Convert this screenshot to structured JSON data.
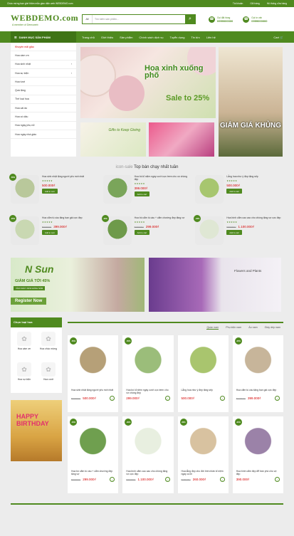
{
  "topbar": {
    "notice": "Chào mừng bạn ghé thăm mẫu giao diện web WEBDEMO.com",
    "links": [
      "Tài khoản",
      "Giỏ hàng",
      "Hệ thống cửa hàng"
    ]
  },
  "header": {
    "logo": "WEBDEMO.com",
    "tagline": "A member of Demoweb",
    "search_cat": "All",
    "search_placeholder": "Tìm kiếm sản phẩm...",
    "contacts": [
      {
        "label": "Gọi đặt hàng",
        "value": "0999000000"
      },
      {
        "label": "Gọi tư vấn",
        "value": "0999000000"
      }
    ]
  },
  "nav": {
    "menu_label": "DANH MỤC SẢN PHẨM",
    "items": [
      "Trang chủ",
      "Giới thiệu",
      "Sản phẩm",
      "Chính sách dịch vụ",
      "Tuyển dụng",
      "Tin tức",
      "Liên hệ"
    ],
    "cart": "Cart"
  },
  "sidebar": [
    "Khuyến mãi giảo",
    "Hoa cầm ơn",
    "Hoa sinh nhật",
    "Hoa sự kiện",
    "Hoa tươi",
    "Quà tặng",
    "Thế loại hoa",
    "Hoa cái ảo",
    "Hoa có dâu",
    "Hoa ngày phụ nữ",
    "Hoa ngày nhà giáo"
  ],
  "banners": {
    "main_title": "Hoa xinh xuống phố",
    "main_sale": "Sale to 25%",
    "gift": "Gifts to Keep Giving",
    "side": "GIẢM GIÁ KHỦNG"
  },
  "top_selling": {
    "title": "Top bán chạy nhất tuần",
    "img_alt": "icon-sale",
    "products": [
      {
        "name": "Hoa sinh nhật tặng người yêu mới nhất",
        "old": "",
        "price": "500.000₫",
        "badge": "-50%",
        "color": "#b9c89b"
      },
      {
        "name": "Hoa bó kỉ niệm ngày cưới cực teen cho vợ chồng đẹp",
        "old": "",
        "price": "399.000₫",
        "badge": "",
        "color": "#7aa55a"
      },
      {
        "name": "Lẵng hoa như ý đẹp tặng sếp",
        "old": "",
        "price": "500.000₫",
        "badge": "",
        "color": "#a7c66f"
      },
      {
        "name": "Hoa cẩm tú cầu tặng bạn gái cực đẹp",
        "old": "5000000₫",
        "price": "399.000₫",
        "badge": "-20%",
        "color": "#c9d8b2"
      },
      {
        "name": "Hoa bó cẩm tú cầu + cẩm chướng đẹp tặng vợ",
        "old": "5000000₫",
        "price": "299.000₫",
        "badge": "-40%",
        "color": "#6e9a4a"
      },
      {
        "name": "Hoa bình cẩm cao cao cho chồng tặng vợ cực đẹp",
        "old": "5000000₫",
        "price": "1.100.000₫",
        "badge": "-30%",
        "color": "#dfe7d4"
      }
    ],
    "add_label": "Add to cart"
  },
  "promo": {
    "nsun": "N Sun",
    "sale": "GIẢM GIÁ TỚI 45%",
    "sub": "VÀO NGÀY 20/10 HÀNG NĂM",
    "register": "Register Now",
    "right": "Flowers and Plants"
  },
  "categories": {
    "title": "Chọn loại hoa",
    "items": [
      "Hoa cám ơn",
      "Hoa chúc mừng",
      "Hoa sự kiện",
      "Hoa cưới"
    ],
    "bday": "HAPPY BIRTHDAY"
  },
  "tabs": [
    "Quần nam",
    "Phụ kiện nam",
    "Áo nam",
    "Giày dép nam"
  ],
  "products": [
    {
      "name": "Hoa sinh nhật tặng người yêu mới nhất",
      "old": "5000000₫",
      "price": "500.000₫",
      "badge": "-50%",
      "color": "#b6a078"
    },
    {
      "name": "Hoa bó kỉ niệm ngày cưới cực teen cho vợ chồng đẹp",
      "old": "",
      "price": "299.000₫",
      "badge": "-50%",
      "color": "#9bbd7a"
    },
    {
      "name": "Lẵng hoa như ý đẹp tặng sếp",
      "old": "",
      "price": "500.000₫",
      "badge": "",
      "color": "#a9c56e"
    },
    {
      "name": "Hoa cẩm tú cầu tặng bạn gái cực đẹp",
      "old": "5000000₫",
      "price": "399.000₫",
      "badge": "-20%",
      "color": "#c7b59a"
    },
    {
      "name": "Hoa bó cẩm tú cầu + cẩm chướng đẹp tặng vợ",
      "old": "5000000₫",
      "price": "299.000₫",
      "badge": "-40%",
      "color": "#6f9f4f"
    },
    {
      "name": "Hoa bình cẩm cao cao cho chồng tặng vợ cực đẹp",
      "old": "5000000₫",
      "price": "1.100.000₫",
      "badge": "-30%",
      "color": "#e8efe0"
    },
    {
      "name": "Hoa lẵng đẹp cho đời tình nhân kỉ niệm ngày cưới",
      "old": "5000000₫",
      "price": "260.000₫",
      "badge": "-30%",
      "color": "#d8c2a0"
    },
    {
      "name": "Hoa bình cẩm đẹp để bàn phò cho vợ đẹp",
      "old": "",
      "price": "390.000₫",
      "badge": "-34%",
      "color": "#9b82a8"
    }
  ]
}
